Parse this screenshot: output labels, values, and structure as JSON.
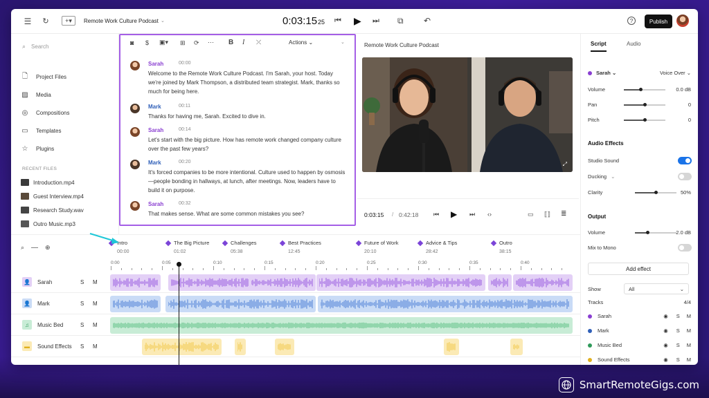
{
  "topbar": {
    "project_title": "Remote Work Culture Podcast",
    "timecode": "0:03:15",
    "timecode_frames": "25",
    "publish_label": "Publish"
  },
  "sidebar": {
    "search_placeholder": "Search",
    "items": [
      {
        "label": "Project Files",
        "icon": "file-icon"
      },
      {
        "label": "Media",
        "icon": "image-icon"
      },
      {
        "label": "Compositions",
        "icon": "compositions-icon"
      },
      {
        "label": "Templates",
        "icon": "templates-icon"
      },
      {
        "label": "Plugins",
        "icon": "plugins-icon"
      }
    ],
    "recent_heading": "RECENT FILES",
    "recent_files": [
      {
        "name": "Introduction.mp4",
        "thumb_color": "#3a3a3a"
      },
      {
        "name": "Guest Interview.mp4",
        "thumb_color": "#5a4a3a"
      },
      {
        "name": "Research Study.wav",
        "thumb_color": "#444"
      },
      {
        "name": "Outro Music.mp3",
        "thumb_color": "#555"
      }
    ]
  },
  "transcript": {
    "actions_label": "Actions",
    "entries": [
      {
        "speaker": "Sarah",
        "time": "00:00",
        "text": "Welcome to the Remote Work Culture Podcast. I'm Sarah, your host. Today we're joined by Mark Thompson, a distributed team strategist. Mark, thanks so much for being here."
      },
      {
        "speaker": "Mark",
        "time": "00:11",
        "text": "Thanks for having me, Sarah. Excited to dive in."
      },
      {
        "speaker": "Sarah",
        "time": "00:14",
        "text": "Let's start with the big picture. How has remote work changed company culture over the past few years?"
      },
      {
        "speaker": "Mark",
        "time": "00:20",
        "text": "It's forced companies to be more intentional. Culture used to happen by osmosis—people bonding in hallways, at lunch, after meetings. Now, leaders have to build it on purpose."
      },
      {
        "speaker": "Sarah",
        "time": "00:32",
        "text": "That makes sense. What are some common mistakes you see?"
      }
    ],
    "colors": {
      "Sarah": "#8a3fd1",
      "Mark": "#2f5fb8"
    }
  },
  "preview": {
    "title": "Remote Work Culture Podcast",
    "current_time": "0:03:15",
    "separator": "/",
    "total_time": "0:42:18"
  },
  "chapters": [
    {
      "label": "Intro",
      "time": "00:00"
    },
    {
      "label": "The Big Picture",
      "time": "01:02"
    },
    {
      "label": "Challenges",
      "time": "05:38"
    },
    {
      "label": "Best Practices",
      "time": "12:45"
    },
    {
      "label": "Future of Work",
      "time": "20:10"
    },
    {
      "label": "Advice & Tips",
      "time": "28:42"
    },
    {
      "label": "Outro",
      "time": "38:15"
    }
  ],
  "ruler_ticks": [
    "0:00",
    "0:05",
    "0:10",
    "0:15",
    "0:20",
    "0:25",
    "0:30",
    "0:35",
    "0:40"
  ],
  "tracks": [
    {
      "name": "Sarah",
      "solo": "S",
      "mute": "M",
      "color": "#8a3fd1",
      "bg": "#e3d0f6",
      "wave": "#9a5ce0"
    },
    {
      "name": "Mark",
      "solo": "S",
      "mute": "M",
      "color": "#2f5fb8",
      "bg": "#c9dbf6",
      "wave": "#4d7fd6"
    },
    {
      "name": "Music Bed",
      "solo": "S",
      "mute": "M",
      "color": "#2f9a5a",
      "bg": "#c8ecd6",
      "wave": "#5cbf84"
    },
    {
      "name": "Sound Effects",
      "solo": "S",
      "mute": "M",
      "color": "#e0b020",
      "bg": "#fbeab5",
      "wave": "#f2c84a"
    }
  ],
  "right_panel": {
    "tabs": [
      "Script",
      "Audio"
    ],
    "active_tab": "Script",
    "speaker": "Sarah",
    "voice": "Voice Over",
    "volume_label": "Volume",
    "volume_value": "0.0 dB",
    "volume_level": 0.4,
    "pan_label": "Pan",
    "pan_value": "0",
    "pan_level": 0.5,
    "pitch_label": "Pitch",
    "pitch_value": "0",
    "pitch_level": 0.5,
    "audio_effects_heading": "Audio Effects",
    "studio_sound_label": "Studio Sound",
    "studio_sound_on": true,
    "ducking_label": "Ducking",
    "ducking_on": false,
    "clarity_label": "Clarity",
    "clarity_value": "50%",
    "clarity_level": 0.5,
    "output_heading": "Output",
    "out_volume_label": "Volume",
    "out_volume_value": "-2.0 dB",
    "out_volume_level": 0.3,
    "mix_mono_label": "Mix to Mono",
    "mix_mono_on": false,
    "add_effect_label": "Add effect",
    "show_label": "Show",
    "show_value": "All",
    "tracks_label": "Tracks",
    "tracks_count": "4/4",
    "track_list": [
      {
        "name": "Sarah",
        "color": "#8a3fd1"
      },
      {
        "name": "Mark",
        "color": "#2f5fb8"
      },
      {
        "name": "Music Bed",
        "color": "#2f9a5a"
      },
      {
        "name": "Sound Effects",
        "color": "#e0b020"
      }
    ],
    "accent": "#1a73e8"
  },
  "watermark": {
    "text": "SmartRemoteGigs.com"
  }
}
